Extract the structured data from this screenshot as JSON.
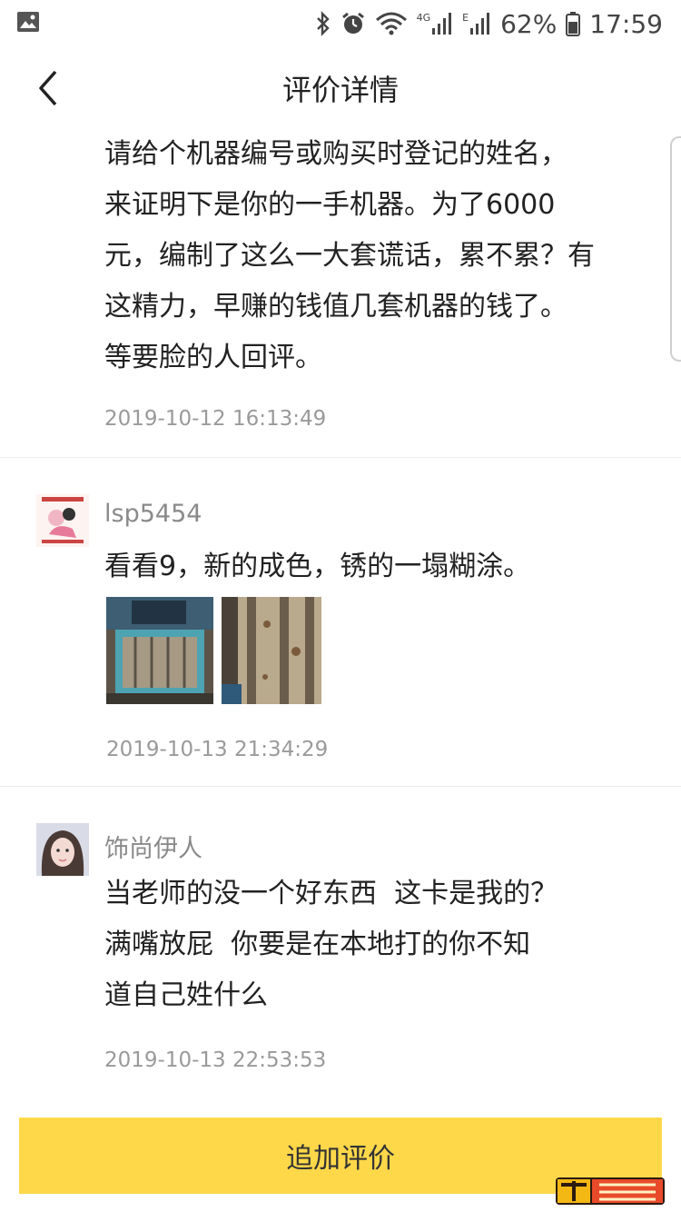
{
  "status_bar": {
    "battery": "62%",
    "time": "17:59",
    "network_4g": "4G",
    "network_e": "E"
  },
  "nav": {
    "title": "评价详情"
  },
  "reviews": [
    {
      "text": "请给个机器编号或购买时登记的姓名，\n来证明下是你的一手机器。为了6000\n元，编制了这么一大套谎话，累不累？有\n这精力，早赚的钱值几套机器的钱了。\n等要脸的人回评。",
      "time": "2019-10-12 16:13:49"
    },
    {
      "username": "lsp5454",
      "text": "看看9，新的成色，锈的一塌糊涂。",
      "time": "2019-10-13 21:34:29",
      "images": 2
    },
    {
      "username": "饰尚伊人",
      "text": "当老师的没一个好东西  这卡是我的？\n满嘴放屁  你要是在本地打的你不知\n道自己姓什么",
      "time": "2019-10-13 22:53:53"
    }
  ],
  "footer": {
    "add_review_label": "追加评价"
  },
  "colors": {
    "accent": "#ffd84a",
    "muted_text": "#9a9a9a",
    "divider": "#ececec"
  },
  "icons": {
    "back": "chevron-left-icon",
    "gallery": "image-icon",
    "bluetooth": "bluetooth-icon",
    "alarm": "alarm-icon",
    "wifi": "wifi-icon",
    "signal": "signal-icon",
    "battery": "battery-icon"
  }
}
